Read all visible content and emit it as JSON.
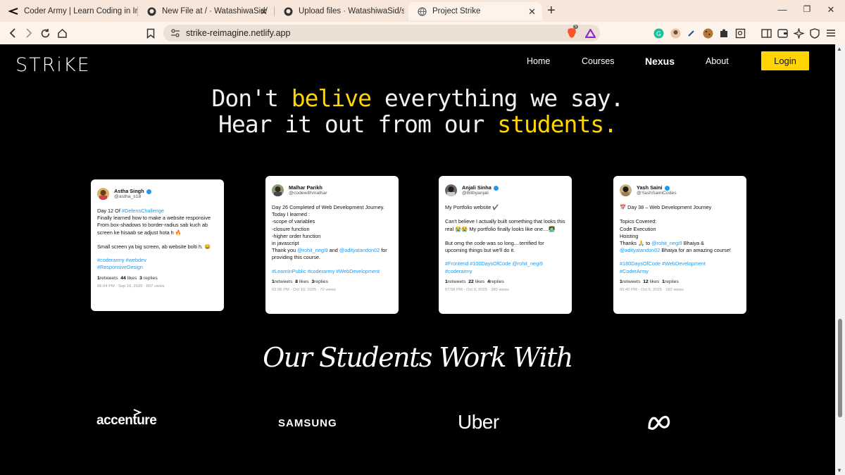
{
  "browser": {
    "tabs": [
      {
        "title": "Coder Army | Learn Coding in India"
      },
      {
        "title": "New File at / · WatashiwaSid/strike-cs"
      },
      {
        "title": "Upload files · WatashiwaSid/strike-cs"
      },
      {
        "title": "Project Strike"
      }
    ],
    "url": "strike-reimagine.netlify.app",
    "brave_badge": "5"
  },
  "site": {
    "logo": "STRiKE",
    "nav": [
      "Home",
      "Courses",
      "Nexus",
      "About"
    ],
    "login": "Login"
  },
  "hero": {
    "line1_a": "Don't ",
    "line1_b": "belive",
    "line1_c": " everything we say.",
    "line2_a": "Hear it out from our ",
    "line2_b": "students."
  },
  "tweets": [
    {
      "name": "Astha Singh",
      "handle": "@astha_s18",
      "intro": "Day 12 Of ",
      "intro_tag": "#DefensChallenge",
      "body": "Finally learned how to make a website responsive\nFrom box-shadows to border-radius sab kuch ab screen ke hisaab se adjust hota h 🔥\n\nSmall screen ya big screen, ab website bolti h. 😄",
      "tags": "#coderarmy #webdev\n#ResponsiveDesign",
      "retweets": "1",
      "likes": "44",
      "replies": "3",
      "meta": "06:04 PM · Sep 16, 2025 · 897 views"
    },
    {
      "name": "Malhar Parikh",
      "handle": "@codewithmalhar",
      "body": "Day 26 Completed of Web Development Journey.\nToday I learned :\n-scope of variables\n-closure function\n-higher order function\nin javascript\n",
      "thanks_a": "Thank you ",
      "thanks_m1": "@rohit_negi9",
      "thanks_b": " and ",
      "thanks_m2": "@adityatandon02",
      "thanks_c": " for providing this course.",
      "tags": "#LearnInPublic #coderarmy #WebDevelopment",
      "retweets": "1",
      "likes": "8",
      "replies": "3",
      "meta": "02:06 PM · Oct 10, 2025 · 70 views"
    },
    {
      "name": "Anjali Sinha",
      "handle": "@Bitbyanjali",
      "body": "My Portfolio website ✔️\n\nCan't believe I actually built something that looks this real 😭😭 My portfolio finally looks like one....👩‍💻\n\nBut omg the code was so long....terrified for upcoming things but we'll do it.",
      "tags": "#Frontend #100DaysOfCode @rohit_negi9\n#coderarmy",
      "retweets": "1",
      "likes": "22",
      "replies": "4",
      "meta": "07:58 PM · Oct 9, 2025 · 280 views"
    },
    {
      "name": "Yash Saini",
      "handle": "@YashSainiCodes",
      "body": "📅 Day 38 – Web Development Journey\n\nTopics Covered:\nCode Execution\nHoisting\n",
      "thanks_a": "Thanks 🙏 to ",
      "thanks_m1": "@rohit_negi9",
      "thanks_b": " Bhaiya & ",
      "thanks_m2": "@adityatandon02",
      "thanks_c": " Bhaiya for an amazing course!",
      "tags": "#180DaysOfCode #WebDevelopment\n#CoderArmy",
      "retweets": "1",
      "likes": "12",
      "replies": "1",
      "meta": "05:40 PM · Oct 6, 2025 · 182 views"
    }
  ],
  "stats_labels": {
    "retweets": "retweets",
    "likes": "likes",
    "replies": "replies"
  },
  "work": {
    "title": "Our Students Work With",
    "brands": [
      "accenture",
      "SAMSUNG",
      "Uber",
      "Meta"
    ]
  }
}
